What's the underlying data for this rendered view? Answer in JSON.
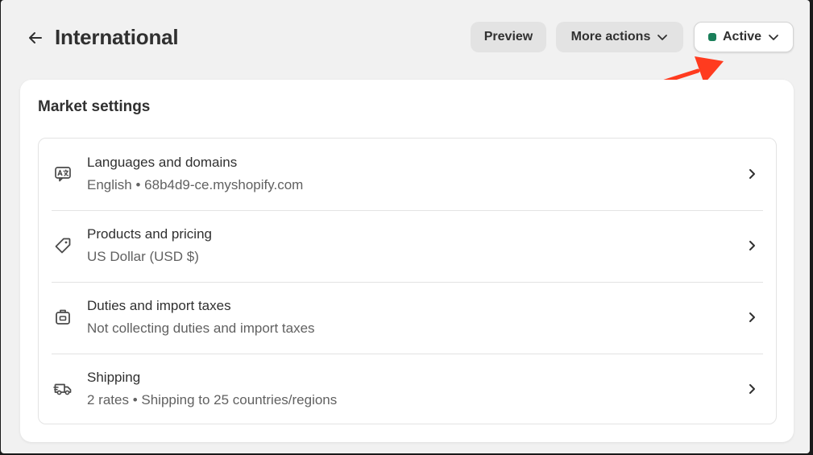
{
  "header": {
    "title": "International",
    "back_icon": "arrow-left-icon",
    "preview_label": "Preview",
    "more_actions_label": "More actions",
    "status_label": "Active",
    "status_color": "#1a7f5a"
  },
  "annotation": {
    "arrow_color": "#ff3b1f"
  },
  "market_settings": {
    "title": "Market settings",
    "items": [
      {
        "icon": "language-icon",
        "title": "Languages and domains",
        "subtitle": "English • 68b4d9-ce.myshopify.com"
      },
      {
        "icon": "price-tag-icon",
        "title": "Products and pricing",
        "subtitle": "US Dollar (USD $)"
      },
      {
        "icon": "package-duties-icon",
        "title": "Duties and import taxes",
        "subtitle": "Not collecting duties and import taxes"
      },
      {
        "icon": "delivery-truck-icon",
        "title": "Shipping",
        "subtitle": "2 rates • Shipping to 25 countries/regions"
      }
    ]
  }
}
